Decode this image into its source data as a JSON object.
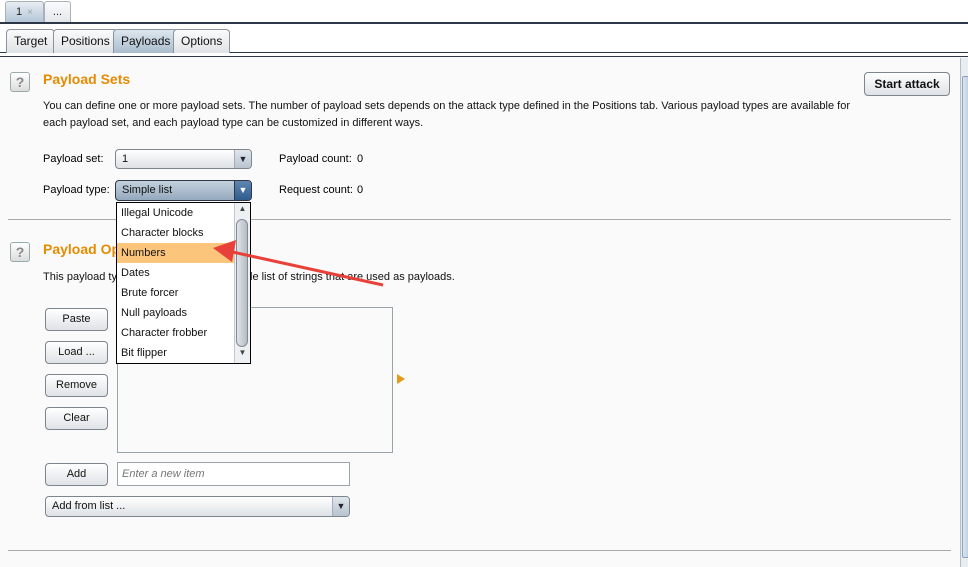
{
  "top_tabs": [
    {
      "label": "1",
      "close": "×",
      "active": true
    },
    {
      "label": "...",
      "active": false
    }
  ],
  "sub_tabs": [
    {
      "label": "Target",
      "active": false
    },
    {
      "label": "Positions",
      "active": false
    },
    {
      "label": "Payloads",
      "active": true
    },
    {
      "label": "Options",
      "active": false
    }
  ],
  "payload_sets": {
    "title": "Payload Sets",
    "description_line1": "You can define one or more payload sets. The number of payload sets depends on the attack type defined in the Positions tab. Various payload types are available for",
    "description_line2": "each payload set, and each payload type can be customized in different ways.",
    "start_attack_label": "Start attack",
    "payload_set_label": "Payload set:",
    "payload_set_value": "1",
    "payload_type_label": "Payload type:",
    "payload_type_value": "Simple list",
    "payload_count_label": "Payload count:",
    "payload_count_value": "0",
    "request_count_label": "Request count:",
    "request_count_value": "0"
  },
  "payload_type_dropdown": {
    "options": [
      "Illegal Unicode",
      "Character blocks",
      "Numbers",
      "Dates",
      "Brute forcer",
      "Null payloads",
      "Character frobber",
      "Bit flipper"
    ],
    "highlighted": "Numbers"
  },
  "payload_options": {
    "title_visible": "Payload Op",
    "desc_left_visible": "This payload ty",
    "desc_right_visible": "le list of strings that are used as payloads.",
    "buttons": {
      "paste": "Paste",
      "load": "Load ...",
      "remove": "Remove",
      "clear": "Clear",
      "add": "Add"
    },
    "new_item_placeholder": "Enter a new item",
    "add_from_list_value": "Add from list ..."
  },
  "colors": {
    "section_title": "#e58b00",
    "highlight": "#fbc67c",
    "annotation_arrow": "#e8413a"
  }
}
